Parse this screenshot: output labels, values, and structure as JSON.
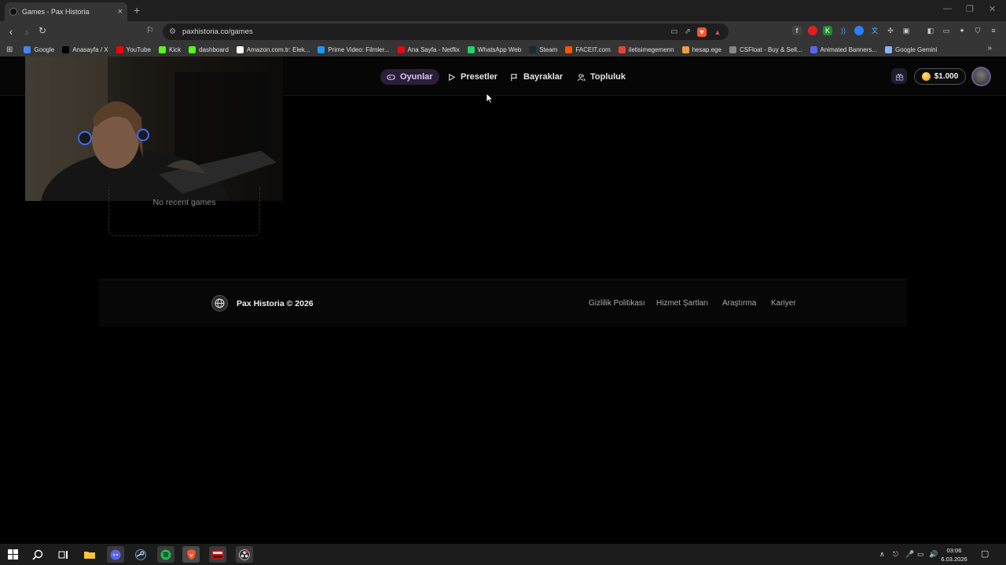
{
  "browser": {
    "tab_title": "Games - Pax Historia",
    "tab_close": "×",
    "new_tab": "+",
    "url": "paxhistoria.co/games",
    "bookmarks": [
      {
        "label": "Google",
        "color": "#4285f4"
      },
      {
        "label": "Anasayfa / X",
        "color": "#000000"
      },
      {
        "label": "YouTube",
        "color": "#ff0000"
      },
      {
        "label": "Kick",
        "color": "#53fc18"
      },
      {
        "label": "dashboard",
        "color": "#53fc18"
      },
      {
        "label": "Amazon.com.tr: Elek...",
        "color": "#ffffff"
      },
      {
        "label": "Prime Video: Filmler...",
        "color": "#1a98ff"
      },
      {
        "label": "Ana Sayfa - Netflix",
        "color": "#e50914"
      },
      {
        "label": "WhatsApp Web",
        "color": "#25d366"
      },
      {
        "label": "Steam",
        "color": "#1b2838"
      },
      {
        "label": "FACEIT.com",
        "color": "#ff5500"
      },
      {
        "label": "iletisimegemenn",
        "color": "#ea4335"
      },
      {
        "label": "hesap.ege",
        "color": "#e8a33d"
      },
      {
        "label": "CSFloat - Buy & Sell...",
        "color": "#888888"
      },
      {
        "label": "Animated Banners...",
        "color": "#5865f2"
      },
      {
        "label": "Google Gemini",
        "color": "#8ab4f8"
      }
    ],
    "bookmarks_more": "»"
  },
  "site": {
    "nav": [
      {
        "label": "Oyunlar",
        "icon": "gamepad-icon",
        "active": true
      },
      {
        "label": "Presetler",
        "icon": "play-icon",
        "active": false
      },
      {
        "label": "Bayraklar",
        "icon": "flag-icon",
        "active": false
      },
      {
        "label": "Topluluk",
        "icon": "users-icon",
        "active": false
      }
    ],
    "balance": "$1.000",
    "recent_empty": "No recent games",
    "footer": {
      "brand": "Pax Historia © 2026",
      "links": [
        "Gizlilik Politikası",
        "Hizmet Şartları",
        "Araştırma",
        "Kariyer"
      ]
    }
  },
  "taskbar": {
    "time": "03:06",
    "date": "6.03.2026"
  },
  "colors": {
    "accent": "#2a1f38",
    "page_bg": "#000000",
    "chrome": "#353535"
  }
}
